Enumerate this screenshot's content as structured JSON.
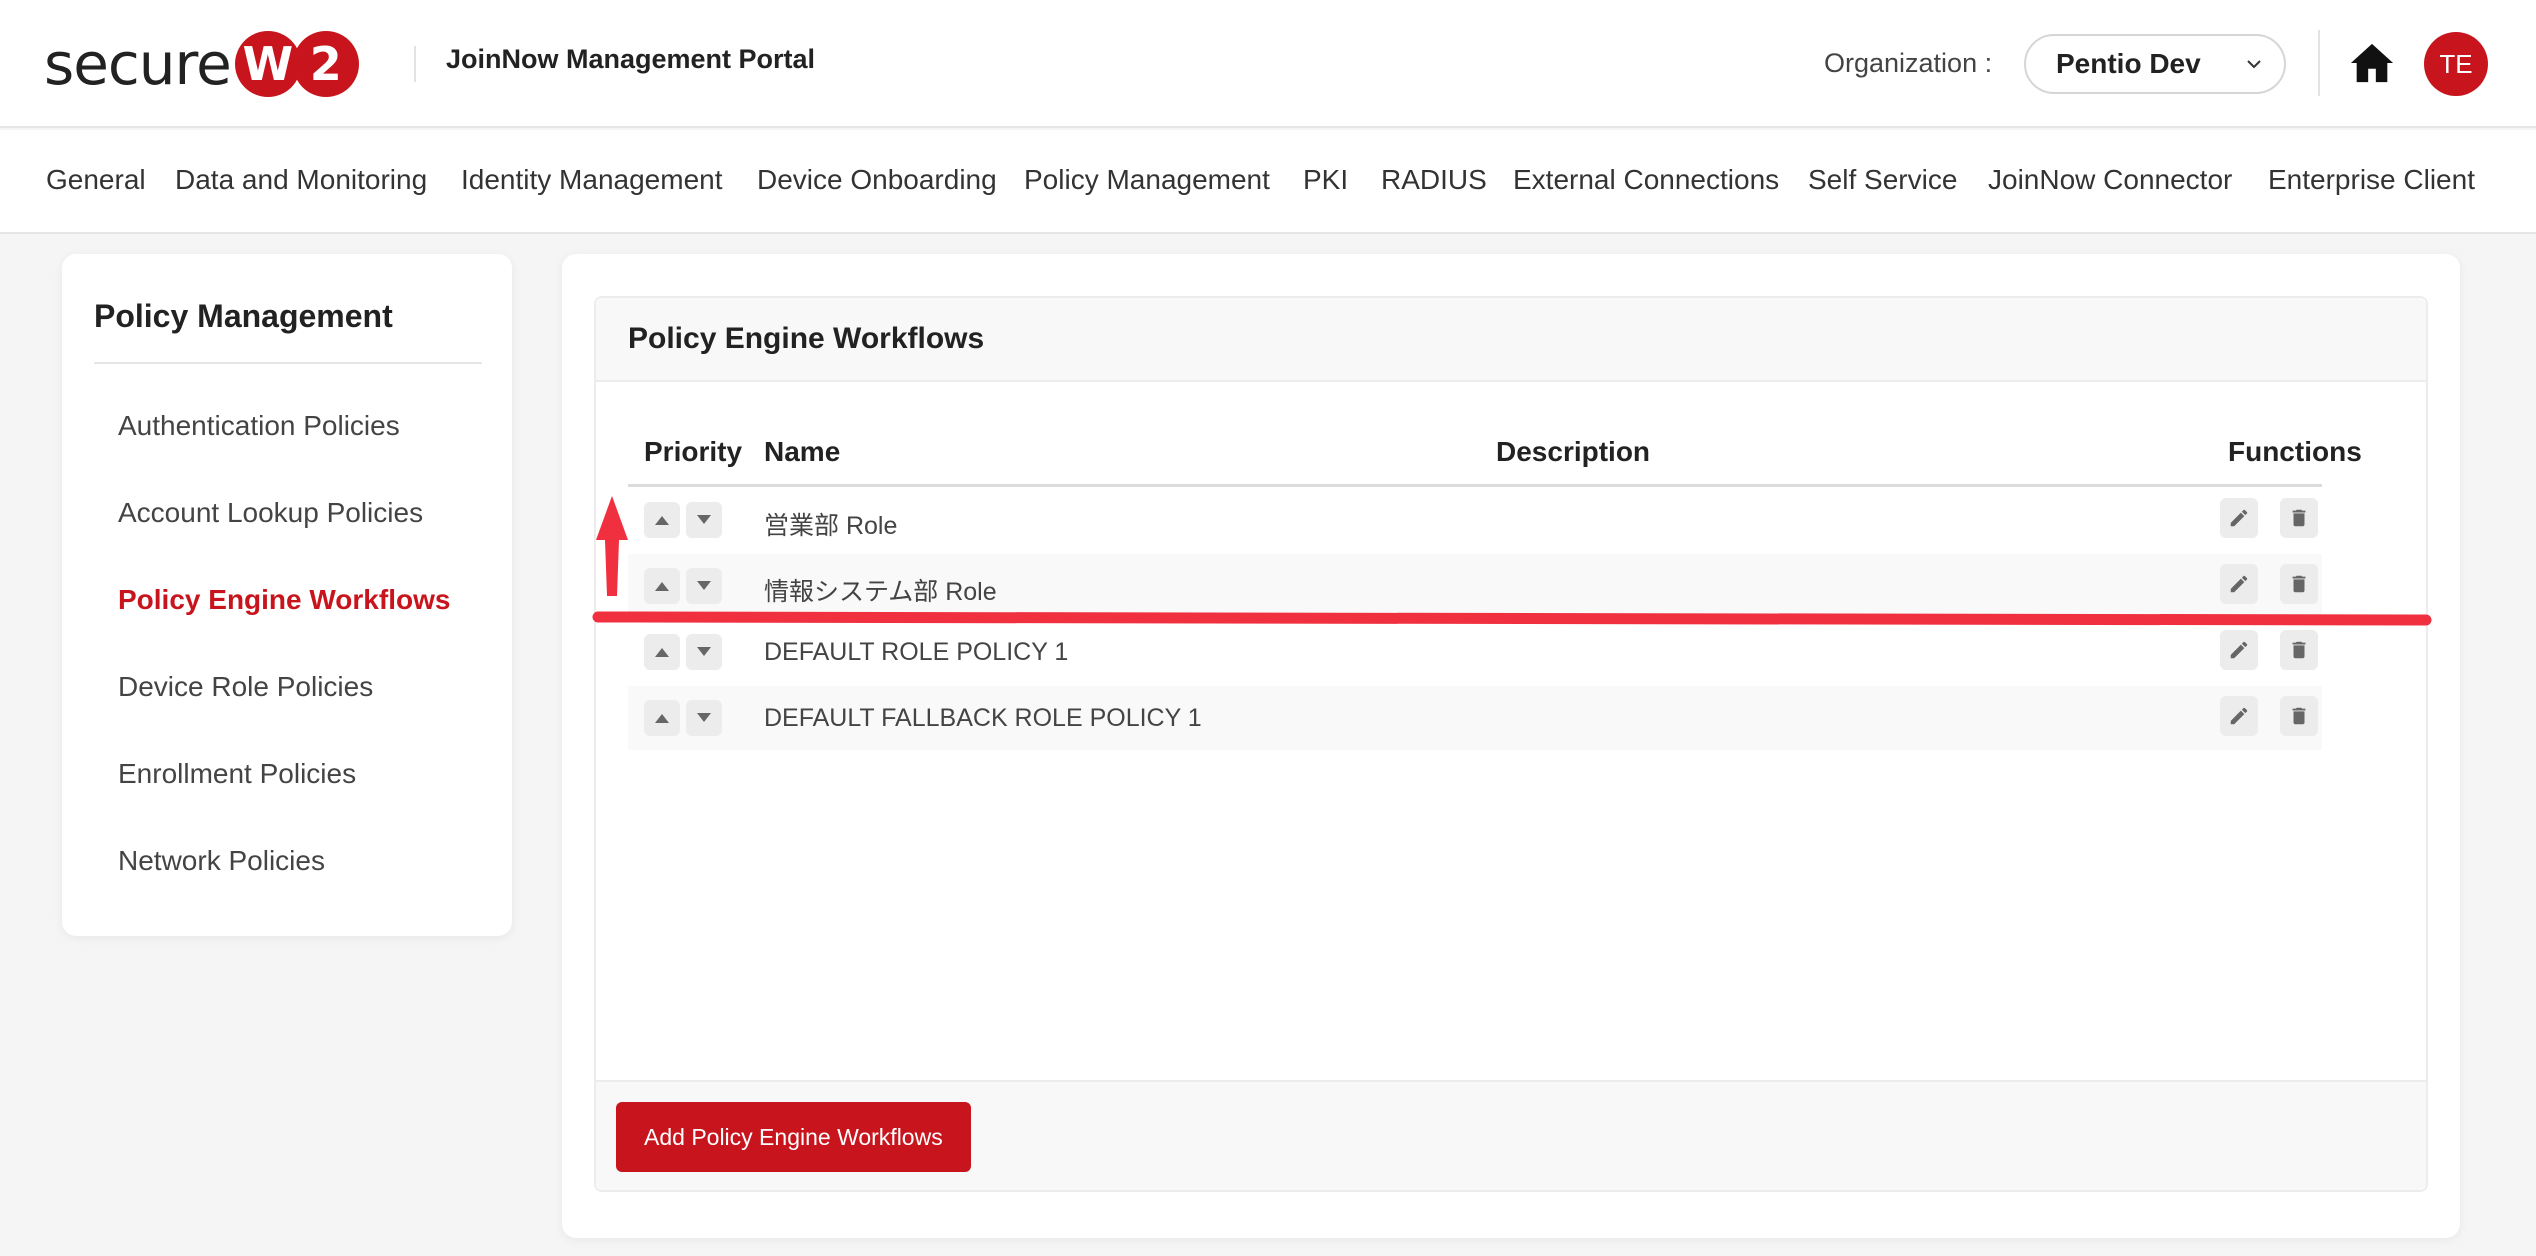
{
  "header": {
    "logo_text": "secure",
    "logo_badge_1": "W",
    "logo_badge_2": "2",
    "portal_title": "JoinNow Management Portal",
    "org_label": "Organization :",
    "org_value": "Pentio Dev",
    "avatar_initials": "TE",
    "brand_color": "#c8151d"
  },
  "nav": {
    "items": [
      "General",
      "Data and Monitoring",
      "Identity Management",
      "Device Onboarding",
      "Policy Management",
      "PKI",
      "RADIUS",
      "External Connections",
      "Self Service",
      "JoinNow Connector",
      "Enterprise Client"
    ]
  },
  "sidebar": {
    "title": "Policy Management",
    "items": [
      {
        "label": "Authentication Policies",
        "active": false
      },
      {
        "label": "Account Lookup Policies",
        "active": false
      },
      {
        "label": "Policy Engine Workflows",
        "active": true
      },
      {
        "label": "Device Role Policies",
        "active": false
      },
      {
        "label": "Enrollment Policies",
        "active": false
      },
      {
        "label": "Network Policies",
        "active": false
      }
    ]
  },
  "main": {
    "card_title": "Policy Engine Workflows",
    "columns": {
      "priority": "Priority",
      "name": "Name",
      "description": "Description",
      "functions": "Functions"
    },
    "rows": [
      {
        "name": "営業部 Role",
        "description": ""
      },
      {
        "name": "情報システム部 Role",
        "description": ""
      },
      {
        "name": "DEFAULT ROLE POLICY 1",
        "description": ""
      },
      {
        "name": "DEFAULT FALLBACK ROLE POLICY 1",
        "description": ""
      }
    ],
    "add_button": "Add Policy Engine Workflows"
  },
  "icons": {
    "home": "home-icon",
    "chevron": "chevron-down-icon",
    "up": "caret-up-icon",
    "down": "caret-down-icon",
    "edit": "pencil-icon",
    "delete": "trash-icon"
  },
  "annotation_color": "#f0303f"
}
